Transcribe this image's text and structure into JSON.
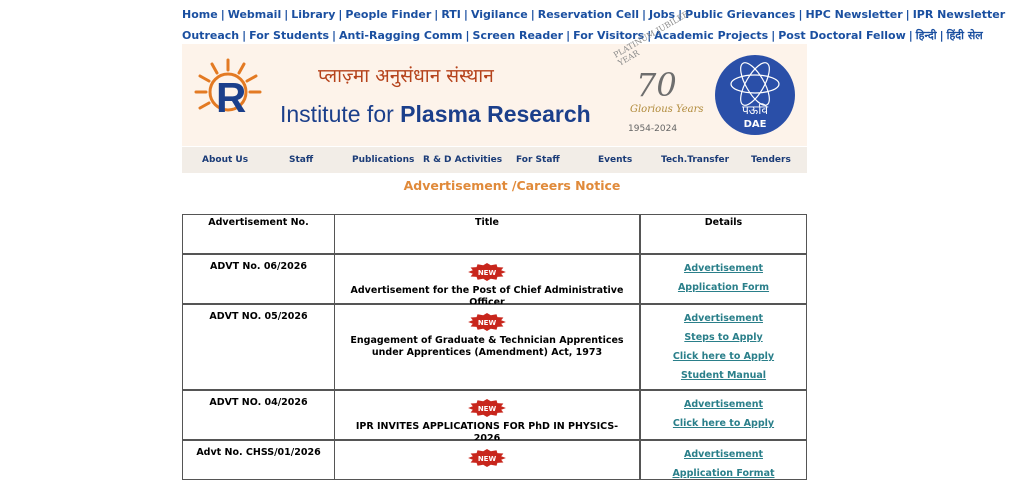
{
  "top_links": {
    "row1": [
      "Home",
      "Webmail",
      "Library",
      "People Finder",
      "RTI",
      "Vigilance",
      "Reservation Cell",
      "Jobs",
      "Public Grievances",
      "HPC Newsletter",
      "IPR Newsletter"
    ],
    "row2": [
      "Outreach",
      "For Students",
      "Anti-Ragging Comm",
      "Screen Reader",
      "For Visitors",
      "Academic Projects",
      "Post Doctoral Fellow",
      "हिन्दी",
      "हिंदी सेल"
    ]
  },
  "banner": {
    "hindi_title": "प्लाज़्मा अनुसंधान संस्थान",
    "eng_title_prefix": "Institute for ",
    "eng_title_bold": "Plasma Research",
    "jubilee_arc": "PLATINUM JUBILEE YEAR",
    "jubilee_number": "70",
    "jubilee_glorious": "Glorious Years",
    "jubilee_years": "1954-2024",
    "dae_hindi": "पऊवि",
    "dae_text": "DAE",
    "dae_arc_top": "राष्ट्र की सेवा में परमाणु",
    "dae_arc_bottom": "ATOMS IN THE SERVICE OF THE NATION"
  },
  "nav": [
    "About Us",
    "Staff",
    "Publications",
    "R & D Activities",
    "For Staff",
    "Events",
    "Tech.Transfer",
    "Tenders"
  ],
  "heading": "Advertisement /Careers Notice",
  "table": {
    "headers": [
      "Advertisement No.",
      "Title",
      "Details"
    ],
    "new_label": "NEW",
    "rows": [
      {
        "no": "ADVT No. 06/2026",
        "title": "Advertisement for the Post of Chief Administrative Officer",
        "links": [
          "Advertisement",
          "Application Form"
        ]
      },
      {
        "no": "ADVT NO. 05/2026",
        "title": "Engagement of Graduate & Technician Apprentices under Apprentices (Amendment) Act, 1973",
        "links": [
          "Advertisement",
          "Steps to Apply",
          "Click here to Apply",
          "Student Manual"
        ]
      },
      {
        "no": "ADVT NO. 04/2026",
        "title": "IPR INVITES APPLICATIONS FOR PhD IN PHYSICS-2026",
        "links": [
          "Advertisement",
          "Click here to Apply"
        ]
      },
      {
        "no": "Advt No. CHSS/01/2026",
        "title": "",
        "links": [
          "Advertisement",
          "Application Format"
        ]
      }
    ]
  },
  "colors": {
    "link_blue": "#1a4fa0",
    "heading_orange": "#e08a3a",
    "detail_link": "#2a7f8a",
    "new_red": "#c8261c"
  }
}
